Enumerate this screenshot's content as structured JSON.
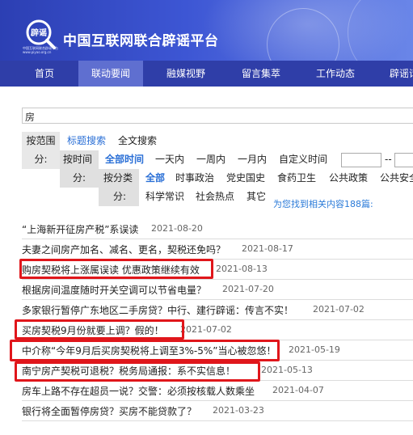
{
  "header": {
    "logo_text": "辟谣",
    "logo_sub": "中国互联网联合辟谣平台 www.piyao.org.cn",
    "site_title": "中国互联网联合辟谣平台",
    "brand_color": "#2f3ea8"
  },
  "nav": {
    "items": [
      "首页",
      "联动要闻",
      "融媒视野",
      "留言集萃",
      "工作动态",
      "辟谣话"
    ],
    "active_index": 1
  },
  "search": {
    "value": "房"
  },
  "filter": {
    "range_label": "按范围分:",
    "range_label_1": "按范围",
    "range_label_2": "分:",
    "range_options": [
      "标题搜索",
      "全文搜索"
    ],
    "time_label_1": "按时间",
    "time_label_2": "分:",
    "time_options": [
      "全部时间",
      "一天内",
      "一周内",
      "一月内",
      "自定义时间"
    ],
    "date_separator": "--",
    "category_label_1": "按分类",
    "category_label_2": "分:",
    "category_options_row1": [
      "全部",
      "时事政治",
      "党史国史",
      "食药卫生",
      "公共政策",
      "公共安全"
    ],
    "category_options_row2": [
      "科学常识",
      "社会热点",
      "其它"
    ]
  },
  "result_count_text": "为您找到相关内容188篇:",
  "results": [
    {
      "title": "“上海新开征房产税”系误读",
      "date": "2021-08-20",
      "highlighted": false
    },
    {
      "title": "夫妻之间房产加名、减名、更名，契税还免吗？",
      "date": "2021-08-17",
      "highlighted": false
    },
    {
      "title": "购房契税将上涨属误读 优惠政策继续有效",
      "date": "2021-08-13",
      "highlighted": true
    },
    {
      "title": "根据房间温度随时开关空调可以节省电量？",
      "date": "2021-07-20",
      "highlighted": false
    },
    {
      "title": "多家银行暂停广东地区二手房贷？中行、建行辟谣：传言不实！",
      "date": "2021-07-02",
      "highlighted": false
    },
    {
      "title": "买房契税9月份就要上调？假的！",
      "date": "2021-07-02",
      "highlighted": true
    },
    {
      "title": "中介称“今年9月后买房契税将上调至3%-5%”当心被忽悠！",
      "date": "2021-05-19",
      "highlighted": true
    },
    {
      "title": "南宁房产契税可退税？税务局通报：系不实信息！",
      "date": "2021-05-13",
      "highlighted": true
    },
    {
      "title": "房车上路不存在超员一说？交警：必须按核载人数乘坐",
      "date": "2021-04-07",
      "highlighted": false
    },
    {
      "title": "银行将全面暂停房贷？买房不能贷款了？",
      "date": "2021-03-23",
      "highlighted": false
    }
  ],
  "highlight_color": "#e0161b"
}
